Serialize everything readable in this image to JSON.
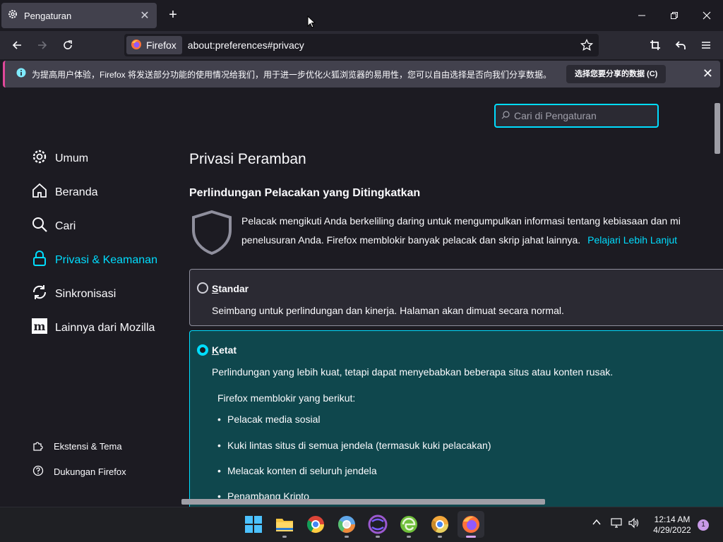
{
  "window": {
    "tab_title": "Pengaturan",
    "new_tab_label": "+"
  },
  "navbar": {
    "identity_label": "Firefox",
    "url": "about:preferences#privacy"
  },
  "notification": {
    "message": "为提高用户体验，Firefox 将发送部分功能的使用情况给我们，用于进一步优化火狐浏览器的易用性，您可以自由选择是否向我们分享数据。",
    "button_label": "选择您要分享的数据 (C)"
  },
  "search": {
    "placeholder": "Cari di Pengaturan"
  },
  "sidebar": {
    "items": [
      {
        "label": "Umum",
        "icon": "gear-icon"
      },
      {
        "label": "Beranda",
        "icon": "home-icon"
      },
      {
        "label": "Cari",
        "icon": "search-icon"
      },
      {
        "label": "Privasi & Keamanan",
        "icon": "lock-icon",
        "active": true
      },
      {
        "label": "Sinkronisasi",
        "icon": "sync-icon"
      },
      {
        "label": "Lainnya dari Mozilla",
        "icon": "mozilla-icon"
      }
    ],
    "footer": [
      {
        "label": "Ekstensi & Tema",
        "icon": "puzzle-icon"
      },
      {
        "label": "Dukungan Firefox",
        "icon": "help-icon"
      }
    ]
  },
  "main": {
    "heading": "Privasi Peramban",
    "section_title": "Perlindungan Pelacakan yang Ditingkatkan",
    "description_line1": "Pelacak mengikuti Anda berkeliling daring untuk mengumpulkan informasi tentang kebiasaan dan mi",
    "description_line2": "penelusuran Anda. Firefox memblokir banyak pelacak dan skrip jahat lainnya.",
    "learn_more": "Pelajari Lebih Lanjut",
    "options": {
      "standard": {
        "title_key": "S",
        "title_rest": "tandar",
        "desc": "Seimbang untuk perlindungan dan kinerja. Halaman akan dimuat secara normal.",
        "selected": false
      },
      "strict": {
        "title_key": "K",
        "title_rest": "etat",
        "desc": "Perlindungan yang lebih kuat, tetapi dapat menyebabkan beberapa situs atau konten rusak.",
        "blocks_label": "Firefox memblokir yang berikut:",
        "blocks": [
          "Pelacak media sosial",
          "Kuki lintas situs di semua jendela (termasuk kuki pelacakan)",
          "Melacak konten di seluruh jendela",
          "Penambang Kripto"
        ],
        "selected": true
      }
    }
  },
  "taskbar": {
    "apps": [
      "start-icon",
      "file-explorer-icon",
      "chrome-icon",
      "chromium-icon",
      "browser-icon",
      "edge-canary-icon",
      "chrome-canary-icon",
      "firefox-icon"
    ],
    "time": "12:14 AM",
    "date": "4/29/2022",
    "notification_count": "1"
  },
  "colors": {
    "accent": "#00ddff",
    "background": "#1c1b22",
    "selected_card": "#0f474d"
  }
}
